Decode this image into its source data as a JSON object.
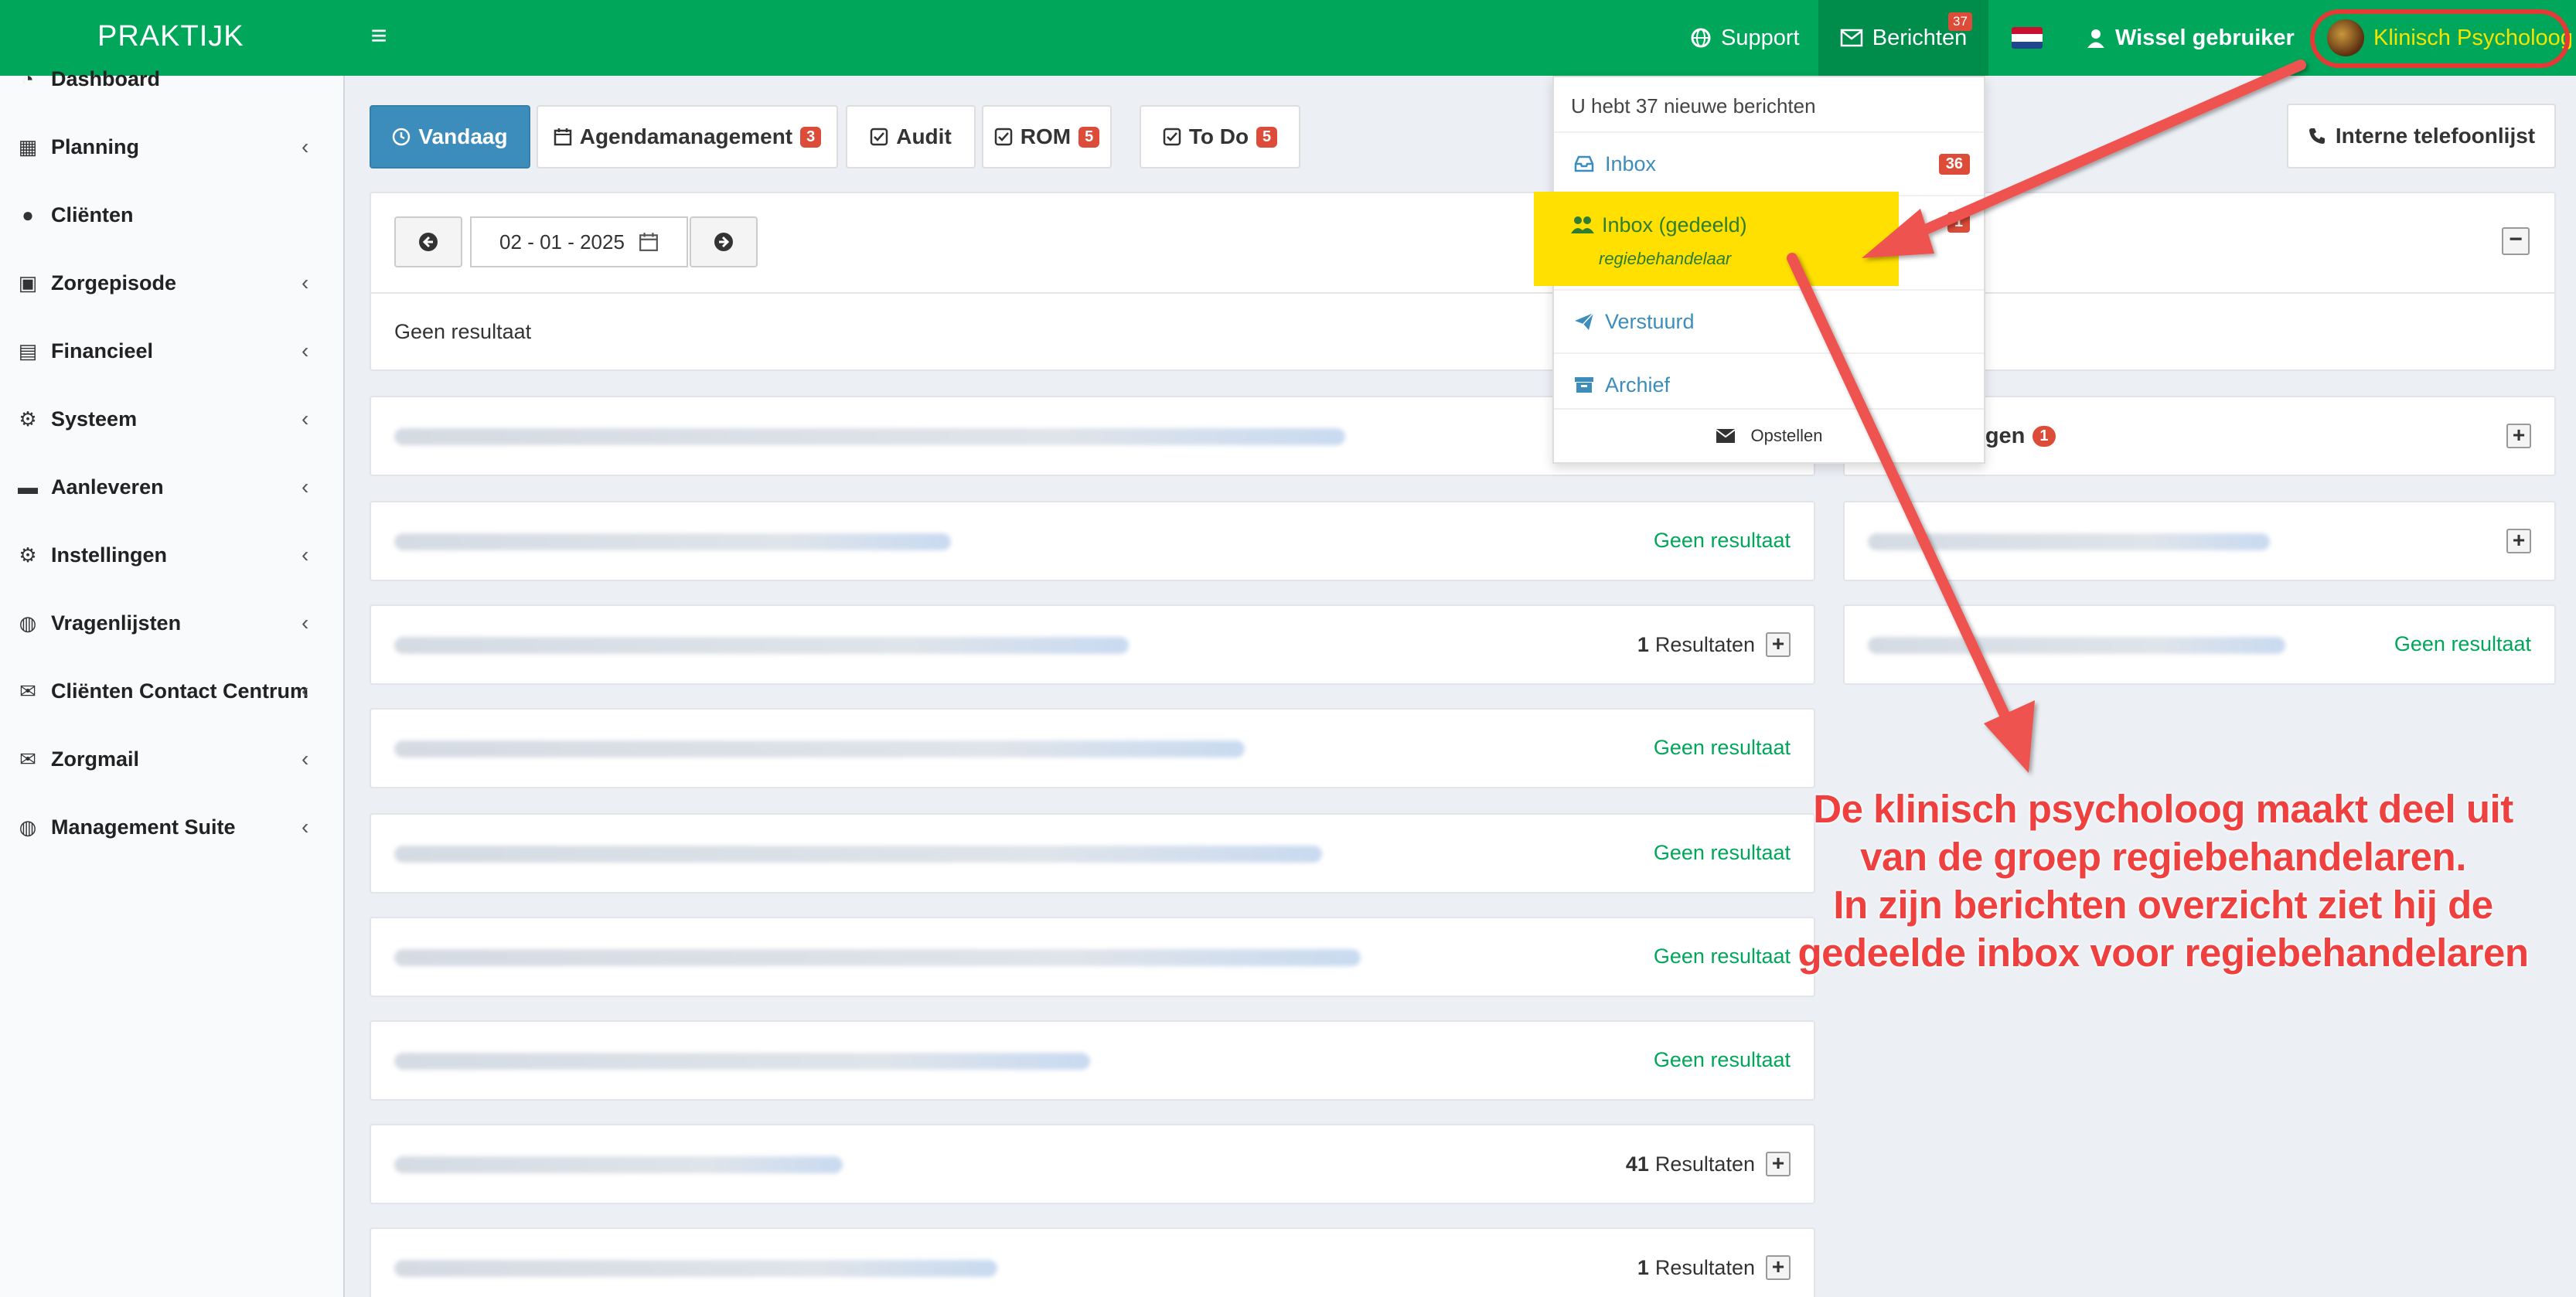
{
  "app": {
    "logo": "PRAKTIJK"
  },
  "topnav": {
    "support": "Support",
    "berichten": "Berichten",
    "berichten_badge": "37",
    "wissel": "Wissel gebruiker",
    "user": "Klinisch Psycholoog"
  },
  "sidebar": {
    "items": [
      {
        "label": "Dashboard",
        "icon": "dashboard-icon",
        "chevron": false
      },
      {
        "label": "Planning",
        "icon": "calendar-icon",
        "chevron": true
      },
      {
        "label": "Cliënten",
        "icon": "user-icon",
        "chevron": false
      },
      {
        "label": "Zorgepisode",
        "icon": "medkit-icon",
        "chevron": true
      },
      {
        "label": "Financieel",
        "icon": "book-icon",
        "chevron": true
      },
      {
        "label": "Systeem",
        "icon": "gears-icon",
        "chevron": true
      },
      {
        "label": "Aanleveren",
        "icon": "truck-icon",
        "chevron": true
      },
      {
        "label": "Instellingen",
        "icon": "gear-icon",
        "chevron": true
      },
      {
        "label": "Vragenlijsten",
        "icon": "globe-icon",
        "chevron": true
      },
      {
        "label": "Cliënten Contact Centrum",
        "icon": "envelope-icon",
        "chevron": true
      },
      {
        "label": "Zorgmail",
        "icon": "envelope-icon",
        "chevron": true
      },
      {
        "label": "Management Suite",
        "icon": "globe-icon",
        "chevron": true
      }
    ]
  },
  "tabs": {
    "vandaag": "Vandaag",
    "agenda": "Agendamanagement",
    "agenda_count": "3",
    "audit": "Audit",
    "rom": "ROM",
    "rom_count": "5",
    "todo": "To Do",
    "todo_count": "5"
  },
  "phonebook": "Interne telefoonlijst",
  "datebar": {
    "date": "02 - 01 - 2025",
    "empty": "Geen resultaat"
  },
  "widgets": [
    {
      "status": ""
    },
    {
      "status": "Geen resultaat"
    },
    {
      "count": "1",
      "status": "Resultaten"
    },
    {
      "status": "Geen resultaat"
    },
    {
      "status": "Geen resultaat"
    },
    {
      "status": "Geen resultaat"
    },
    {
      "status": "Geen resultaat"
    },
    {
      "count": "41",
      "status": "Resultaten"
    },
    {
      "count": "1",
      "status": "Resultaten"
    }
  ],
  "right_widgets": [
    {
      "title": "lingen",
      "count": "1"
    },
    {
      "status": ""
    },
    {
      "status": "Geen resultaat"
    }
  ],
  "dropdown": {
    "header": "U hebt 37 nieuwe berichten",
    "inbox": "Inbox",
    "inbox_count": "36",
    "shared": "Inbox (gedeeld)",
    "shared_sub": "regiebehandelaar",
    "shared_count": "1",
    "sent": "Verstuurd",
    "archive": "Archief",
    "compose": "Opstellen"
  },
  "annotation": {
    "line1": "De klinisch psycholoog maakt deel uit",
    "line2": "van de groep regiebehandelaren.",
    "line3": "In zijn berichten overzicht ziet hij de",
    "line4": "gedeelde inbox voor regiebehandelaren"
  },
  "colors": {
    "brand": "#00a65a",
    "primary": "#3c8dbc",
    "danger": "#dd4b39",
    "highlight": "#ffe000",
    "annotation": "#ef4040"
  }
}
